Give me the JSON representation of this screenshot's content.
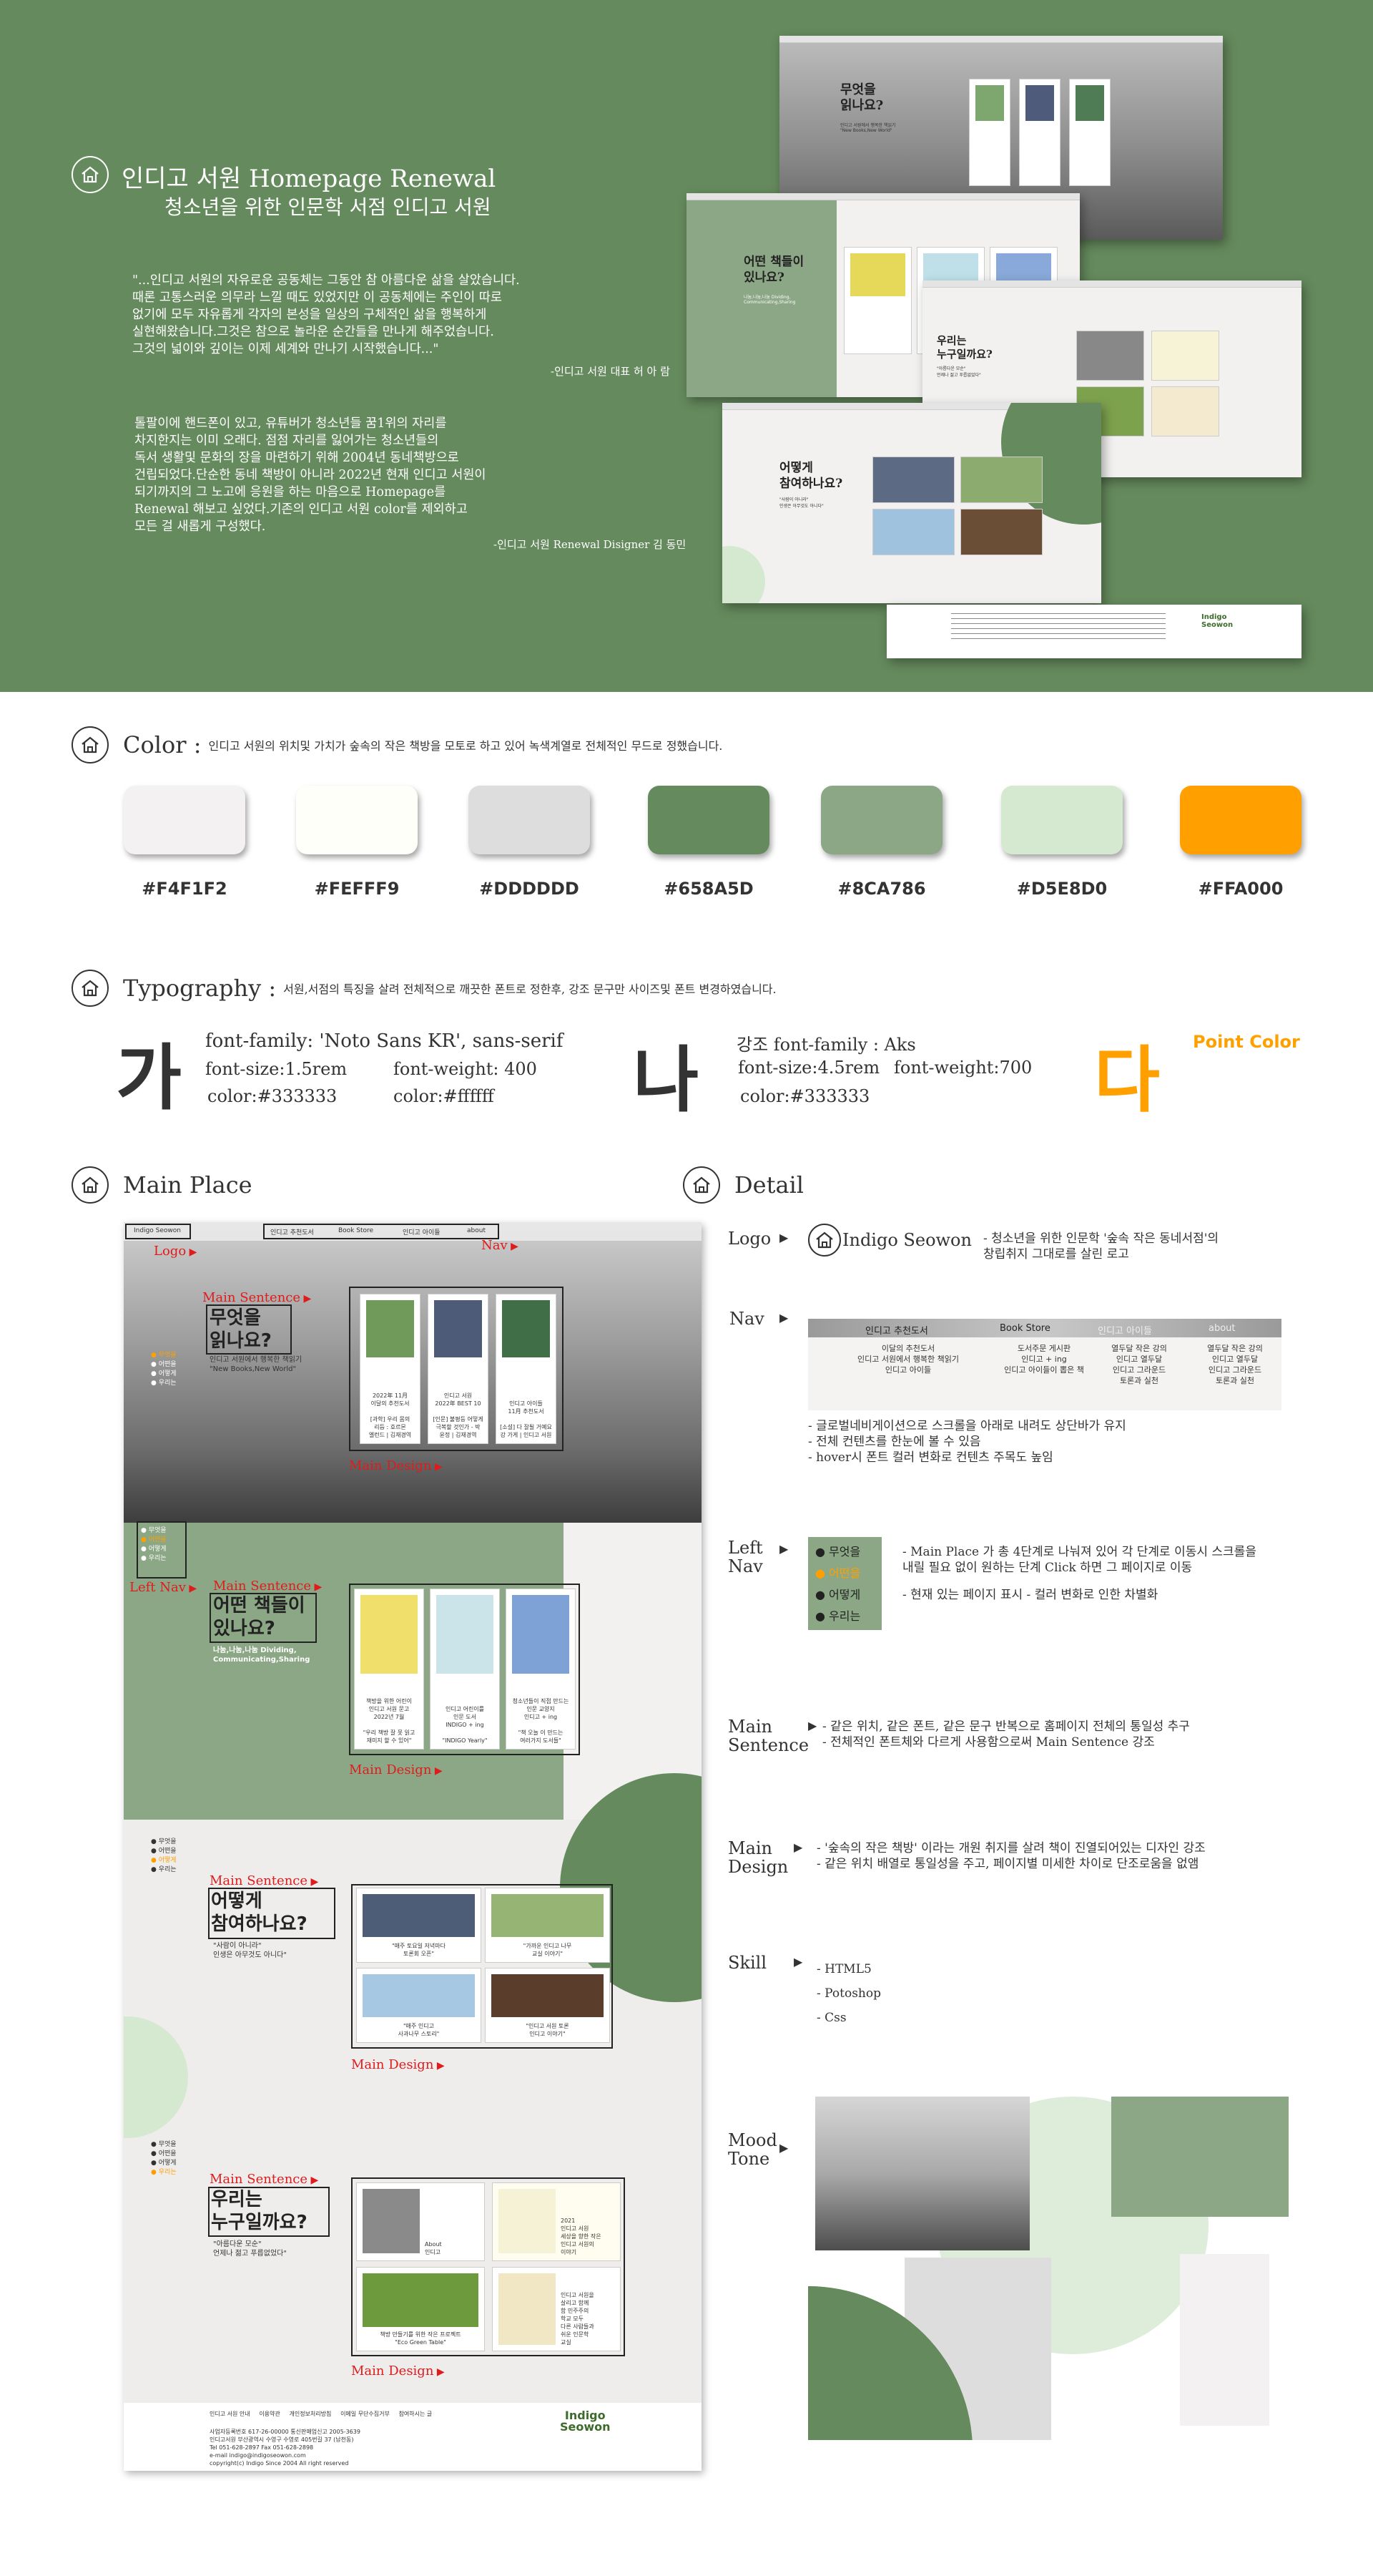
{
  "hero": {
    "title": "인디고 서원 Homepage Renewal",
    "subtitle": "청소년을 위한 인문학 서점 인디고 서원",
    "quote": "\"...인디고 서원의 자유로운 공동체는 그동안 참 아름다운 삶을 살았습니다.\n때론 고통스러운 의무라 느낄 때도 있었지만 이 공동체에는 주인이 따로\n없기에 모두 자유롭게 각자의 본성을 일상의 구체적인 삶을 행복하게\n실현해왔습니다.그것은 참으로 놀라운 순간들을 만나게 해주었습니다.\n그것의 넓이와 깊이는 이제 세계와 만나기 시작했습니다...\"",
    "quote_sign": "-인디고 서원 대표 허 아 람",
    "paragraph": "톨팔이에 핸드폰이 있고, 유튜버가 청소년들 꿈1위의 자리를\n차지한지는 이미 오래다. 점점 자리를 잃어가는 청소년들의\n독서 생활및 문화의 장을 마련하기 위해  2004년 동네책방으로\n건립되었다.단순한 동네 책방이 아니라 2022년 현재 인디고 서원이\n되기까지의 그 노고에 응원을 하는 마음으로 Homepage를\nRenewal 해보고 싶었다.기존의 인디고 서원 color를 제외하고\n모든 걸 새롭게 구성했다.",
    "paragraph_sign": "-인디고 서원 Renewal Disigner 김 동민",
    "shots": {
      "s1_heading": "무엇을\n읽나요?",
      "s1_sub": "인디고 서원에서 행복한 책읽기\n\"New Books,New World\"",
      "s2_heading": "어떤 책들이\n있나요?",
      "s2_sub": "나눔,나눔,나눔 Dividing,\nCommunicating,Sharing",
      "s3_heading": "우리는\n누구일까요?",
      "s3_sub": "\"아름다운 모순\"\n언제나 젊고 푸릅없었다\"",
      "s4_heading": "어떻게\n참여하나요?",
      "s4_sub": "\"사람이 아니라\"\n인생은 아무것도 아니다\""
    }
  },
  "color_section": {
    "title": "Color :",
    "desc": "인디고 서원의 위치및 가치가 숲속의 작은 책방을 모토로 하고 있어 녹색계열로 전체적인 무드로 정했습니다.",
    "swatches": [
      {
        "hex": "#F4F1F2",
        "label": "#F4F1F2"
      },
      {
        "hex": "#FEFFF9",
        "label": "#FEFFF9"
      },
      {
        "hex": "#DDDDDD",
        "label": "#DDDDDD"
      },
      {
        "hex": "#658A5D",
        "label": "#658A5D"
      },
      {
        "hex": "#8CA786",
        "label": "#8CA786"
      },
      {
        "hex": "#D5E8D0",
        "label": "#D5E8D0"
      },
      {
        "hex": "#FFA000",
        "label": "#FFA000"
      }
    ]
  },
  "typography": {
    "title": "Typography :",
    "desc": "서원,서점의 특징을 살려 전체적으로 깨끗한 폰트로 정한후, 강조 문구만 사이즈및 폰트 변경하였습니다.",
    "glyph1": "가",
    "g1_family": "font-family: 'Noto Sans KR', sans-serif",
    "g1_size": "font-size:1.5rem",
    "g1_weight": "font-weight: 400",
    "g1_color": "color:#333333",
    "g1_color2": "color:#ffffff",
    "glyph2": "나",
    "g2_family": "강조 font-family : Aks",
    "g2_size": "font-size:4.5rem",
    "g2_weight": "font-weight:700",
    "g2_color": "color:#333333",
    "glyph3": "다",
    "point_label": "Point Color"
  },
  "main_place": {
    "title": "Main Place",
    "annotations": {
      "logo": "Logo",
      "nav": "Nav",
      "main_sentence": "Main Sentence",
      "main_design": "Main Design",
      "left_nav": "Left Nav"
    },
    "nav_items": [
      "인디고 추천도서",
      "Book Store",
      "인디고 아이들",
      "about"
    ],
    "logo_text": "Indigo Seowon",
    "p1_heading": "무엇을\n읽나요?",
    "p1_sub": "인디고 서원에서 행복한 책읽기\n\"New Books,New World\"",
    "p1_cards": [
      "2022年 11月\n이달의 추천도서\n\n[과학] 우리 몸의\n리듬 : 호르몬\n엘런드 | 김재경역",
      "인디고 서원\n2022年 BEST 10\n\n[인문] 불평등 어떻게\n극복할 것인가 - 박\n윤정 | 김재경역",
      "인디고 아이들\n11月 추천도서\n\n[소설] 다 잘될 거예요\n강 가게 | 인디고 서원"
    ],
    "p2_heading": "어떤 책들이\n있나요?",
    "p2_sub": "나눔,나눔,나눔 Dividing,\nCommunicating,Sharing",
    "p2_cards": [
      "책방을 위한 어린이\n인디고 서원 문고\n2022년 7월\n\n\"우리 책방 잘 못 읽고\n재미지 할 수 있어\"",
      "인디고 어린이를\n인문 도서\nINDIGO + ing\n\n\"INDIGO Yearly\"",
      "청소년들이 직접 만드는\n인문 교양지\n인디고 + ing\n\n\"책 오늘 이 만드는\n여러가지 도서들\""
    ],
    "p3_heading": "어떻게\n참여하나요?",
    "p3_sub": "\"사람이 아니라\"\n인생은 아무것도 아니다\"",
    "p3_cards": [
      "\"매주 토요일 저녁마다\n토론회 오픈\"",
      "\"가까운 인디고 나무\n교실 이야기\"",
      "\"매주 인디고\n사과나무 스토리\"",
      "\"인디고 서원 토론\n인디고 이야기\""
    ],
    "p4_heading": "우리는\n누구일까요?",
    "p4_sub": "\"아름다운 모순\"\n언제나 젊고 푸릅없었다\"",
    "p4_cards": [
      "About\n인디고",
      "2021\n인디고 서원\n세상을 향한 작은\n인디고 서원의\n이야기",
      "책방 만들기를 위한 작은 프로젝트\n\"Eco Green Table\"",
      "인디고 서원을\n살리고 함께\n함 민주주의\n학교 모두\n다른 사람들과\n쉬운 인문학\n교실"
    ],
    "left_nav": [
      "무엇을",
      "어떤을",
      "어떻게",
      "우리는"
    ],
    "footer_links": "인디고 서원 안내     이용약관     개인정보처리방침     이메일 무단수집거부     참여하시는 글",
    "footer_info": "사업자등록번호 617-26-00000 통신판매업신고 2005-3639\n인디고서원 부산광역시 수영구 수영로 405번길 37 (남천동)\nTel 051-628-2897 Fax 051-628-2898\ne-mail indigo@indigoseowon.com\ncopyright(c) Indigo Since 2004 All right reserved",
    "footer_logo": "Indigo\nSeowon"
  },
  "detail": {
    "title": "Detail",
    "logo_label": "Logo",
    "logo_name": "Indigo Seowon",
    "logo_desc": "-  청소년을 위한 인문학 '숲속 작은 동네서점'의\n   창립취지 그대로를 살린 로고",
    "nav_label": "Nav",
    "nav_headers": [
      "인디고 추천도서",
      "Book Store",
      "인디고 아이들",
      "about"
    ],
    "nav_cols": [
      "이달의 추천도서\n인디고 서원에서 행복한 책읽기\n인디고 아이들",
      "도서주문 게시판\n인디고 + ing\n인디고 아이들이 뽑은 책",
      "열두달 작은 강의\n인디고 열두달\n인디고 그라운드\n토론과 실천",
      "열두달 작은 강의\n인디고 열두달\n인디고 그라운드\n토론과 실천"
    ],
    "nav_highlight": "INDIGO + ing",
    "nav_desc": "- 글로벌네비게이션으로 스크롤을 아래로 내려도 상단바가 유지\n- 전체 컨텐츠를 한눈에 볼 수 있음\n-  hover시 폰트 컬러 변화로 컨텐츠 주목도 높임",
    "leftnav_label": "Left\nNav",
    "leftnav_items": [
      "무엇을",
      "어떤을",
      "어떻게",
      "우리는"
    ],
    "leftnav_desc1": "- Main Place 가 총 4단계로 나눠져 있어 각 단계로 이동시 스크롤을\n  내릴 필요 없이 원하는 단계 Click 하면 그 페이지로 이동",
    "leftnav_desc2": "- 현재 있는 페이지 표시 - 컬러 변화로 인한 차별화",
    "ms_label": "Main\nSentence",
    "ms_desc": "- 같은 위치, 같은 폰트, 같은 문구 반복으로 홈페이지 전체의 통일성 추구\n- 전체적인 폰트체와 다르게 사용함으로써 Main Sentence 강조",
    "md_label": "Main\nDesign",
    "md_desc": "- '숲속의 작은 책방' 이라는 개원 취지를 살려 책이 진열되어있는 디자인 강조\n- 같은 위치 배열로 통일성을 주고, 페이지별 미세한 차이로 단조로움을 없앰",
    "skill_label": "Skill",
    "skills": "- HTML5\n- Potoshop\n- Css",
    "mood_label": "Mood\nTone"
  },
  "icons": [
    "home-icon",
    "arrow-right-icon",
    "dot-icon"
  ]
}
